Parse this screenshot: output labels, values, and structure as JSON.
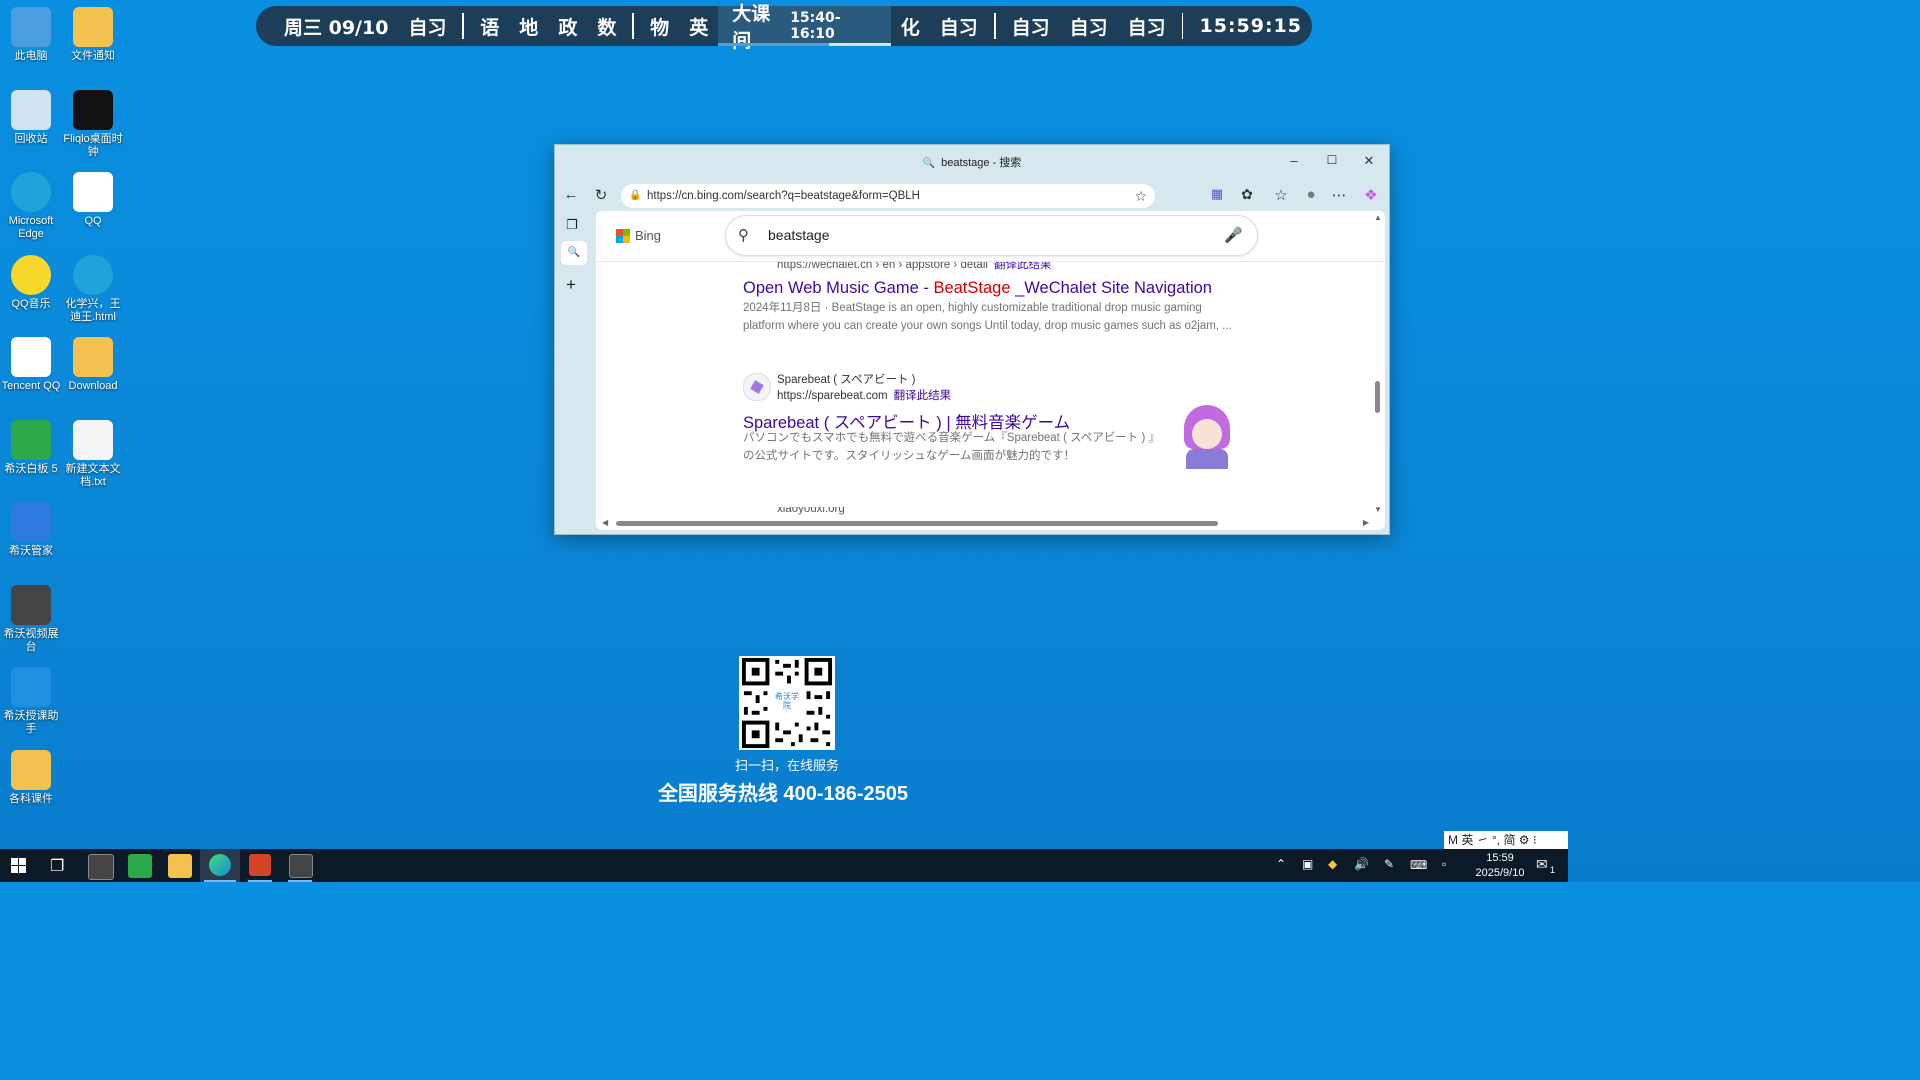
{
  "desktop_icons": [
    {
      "label": "此电脑",
      "icon": "computer-icon"
    },
    {
      "label": "文件通知",
      "icon": "folder-warning-icon"
    },
    {
      "label": "回收站",
      "icon": "recycle-bin-icon"
    },
    {
      "label": "Fliqlo桌面时钟",
      "icon": "clock-icon"
    },
    {
      "label": "Microsoft Edge",
      "icon": "edge-icon"
    },
    {
      "label": "QQ",
      "icon": "qq-icon"
    },
    {
      "label": "QQ音乐",
      "icon": "qq-music-icon"
    },
    {
      "label": "化学兴，王迪王.html",
      "icon": "edge-icon"
    },
    {
      "label": "Tencent QQ",
      "icon": "qq-icon"
    },
    {
      "label": "Download",
      "icon": "folder-icon"
    },
    {
      "label": "希沃白板 5",
      "icon": "seewo-board-icon"
    },
    {
      "label": "新建文本文档.txt",
      "icon": "text-file-icon"
    },
    {
      "label": "希沃管家",
      "icon": "shield-icon"
    },
    {
      "label": "希沃视频展台",
      "icon": "camera-icon"
    },
    {
      "label": "希沃授课助手",
      "icon": "link-icon"
    },
    {
      "label": "各科课件",
      "icon": "folder-icon"
    }
  ],
  "schedule": {
    "date": "周三 09/10",
    "items_a": [
      "自习"
    ],
    "items_b": [
      "语",
      "地",
      "政",
      "数"
    ],
    "items_c": [
      "物",
      "英"
    ],
    "current": {
      "label": "大课间",
      "time": "15:40-16:10",
      "progress": 0.64
    },
    "items_d": [
      "化",
      "自习"
    ],
    "items_e": [
      "自习",
      "自习",
      "自习"
    ],
    "clock": "15:59:15"
  },
  "browser": {
    "window_title": "beatstage - 搜索",
    "url": "https://cn.bing.com/search?q=beatstage&form=QBLH",
    "search_query": "beatstage",
    "bing_label": "Bing",
    "results": [
      {
        "cite_partial": "https://wechalet.cn › en › appstore › detail",
        "translate": "翻译此结果",
        "title_prefix": "Open Web Music Game - ",
        "title_highlight": "BeatStage",
        "title_suffix": " _WeChalet Site Navigation",
        "date": "2024年11月8日",
        "snippet": "BeatStage is an open, highly customizable traditional drop music gaming platform where you can create your own songs Until today, drop music games such as o2jam, ..."
      },
      {
        "site_name": "Sparebeat ( スペアビート )",
        "cite": "https://sparebeat.com",
        "translate": "翻译此结果",
        "title": "Sparebeat ( スペアビート ) | 無料音楽ゲーム",
        "snippet": "パソコンでもスマホでも無料で遊べる音楽ゲーム『Sparebeat ( スペアビート ) 』の公式サイトです。スタイリッシュなゲーム画面が魅力的です！"
      },
      {
        "cite_partial": "xiaoyouxi.org"
      }
    ]
  },
  "qr": {
    "center_text": "希沃学院",
    "caption": "扫一扫，在线服务",
    "hotline": "全国服务热线 400-186-2505"
  },
  "ime": {
    "text": "M 英 ㇀ °, 简 ⚙ ⁝"
  },
  "taskbar": {
    "time": "15:59",
    "date": "2025/9/10",
    "notification_count": "1"
  }
}
